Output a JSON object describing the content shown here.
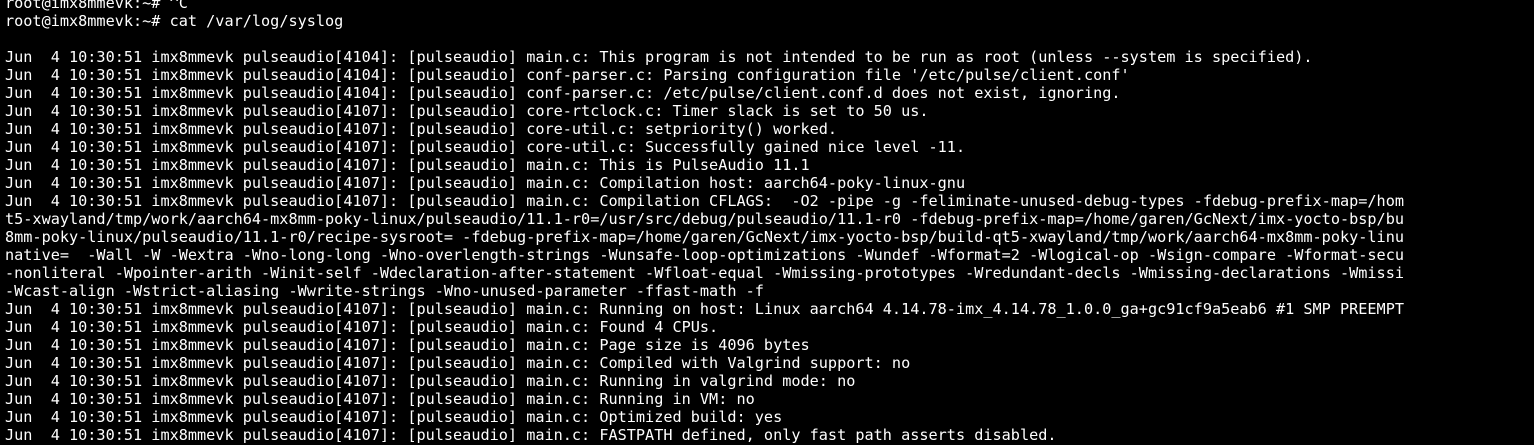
{
  "terminal": {
    "prompt_prev": "root@imx8mmevk:~# ^C",
    "prompt": "root@imx8mmevk:~# ",
    "command": "cat /var/log/syslog",
    "lines": [
      "Jun  4 10:30:51 imx8mmevk pulseaudio[4104]: [pulseaudio] main.c: This program is not intended to be run as root (unless --system is specified).",
      "Jun  4 10:30:51 imx8mmevk pulseaudio[4104]: [pulseaudio] conf-parser.c: Parsing configuration file '/etc/pulse/client.conf'",
      "Jun  4 10:30:51 imx8mmevk pulseaudio[4104]: [pulseaudio] conf-parser.c: /etc/pulse/client.conf.d does not exist, ignoring.",
      "Jun  4 10:30:51 imx8mmevk pulseaudio[4107]: [pulseaudio] core-rtclock.c: Timer slack is set to 50 us.",
      "Jun  4 10:30:51 imx8mmevk pulseaudio[4107]: [pulseaudio] core-util.c: setpriority() worked.",
      "Jun  4 10:30:51 imx8mmevk pulseaudio[4107]: [pulseaudio] core-util.c: Successfully gained nice level -11.",
      "Jun  4 10:30:51 imx8mmevk pulseaudio[4107]: [pulseaudio] main.c: This is PulseAudio 11.1",
      "Jun  4 10:30:51 imx8mmevk pulseaudio[4107]: [pulseaudio] main.c: Compilation host: aarch64-poky-linux-gnu",
      "Jun  4 10:30:51 imx8mmevk pulseaudio[4107]: [pulseaudio] main.c: Compilation CFLAGS:  -O2 -pipe -g -feliminate-unused-debug-types -fdebug-prefix-map=/hom",
      "t5-xwayland/tmp/work/aarch64-mx8mm-poky-linux/pulseaudio/11.1-r0=/usr/src/debug/pulseaudio/11.1-r0 -fdebug-prefix-map=/home/garen/GcNext/imx-yocto-bsp/bu",
      "8mm-poky-linux/pulseaudio/11.1-r0/recipe-sysroot= -fdebug-prefix-map=/home/garen/GcNext/imx-yocto-bsp/build-qt5-xwayland/tmp/work/aarch64-mx8mm-poky-linu",
      "native=  -Wall -W -Wextra -Wno-long-long -Wno-overlength-strings -Wunsafe-loop-optimizations -Wundef -Wformat=2 -Wlogical-op -Wsign-compare -Wformat-secu",
      "-nonliteral -Wpointer-arith -Winit-self -Wdeclaration-after-statement -Wfloat-equal -Wmissing-prototypes -Wredundant-decls -Wmissing-declarations -Wmissi",
      "-Wcast-align -Wstrict-aliasing -Wwrite-strings -Wno-unused-parameter -ffast-math -f",
      "Jun  4 10:30:51 imx8mmevk pulseaudio[4107]: [pulseaudio] main.c: Running on host: Linux aarch64 4.14.78-imx_4.14.78_1.0.0_ga+gc91cf9a5eab6 #1 SMP PREEMPT",
      "Jun  4 10:30:51 imx8mmevk pulseaudio[4107]: [pulseaudio] main.c: Found 4 CPUs.",
      "Jun  4 10:30:51 imx8mmevk pulseaudio[4107]: [pulseaudio] main.c: Page size is 4096 bytes",
      "Jun  4 10:30:51 imx8mmevk pulseaudio[4107]: [pulseaudio] main.c: Compiled with Valgrind support: no",
      "Jun  4 10:30:51 imx8mmevk pulseaudio[4107]: [pulseaudio] main.c: Running in valgrind mode: no",
      "Jun  4 10:30:51 imx8mmevk pulseaudio[4107]: [pulseaudio] main.c: Running in VM: no",
      "Jun  4 10:30:51 imx8mmevk pulseaudio[4107]: [pulseaudio] main.c: Optimized build: yes",
      "Jun  4 10:30:51 imx8mmevk pulseaudio[4107]: [pulseaudio] main.c: FASTPATH defined, only fast path asserts disabled."
    ]
  }
}
